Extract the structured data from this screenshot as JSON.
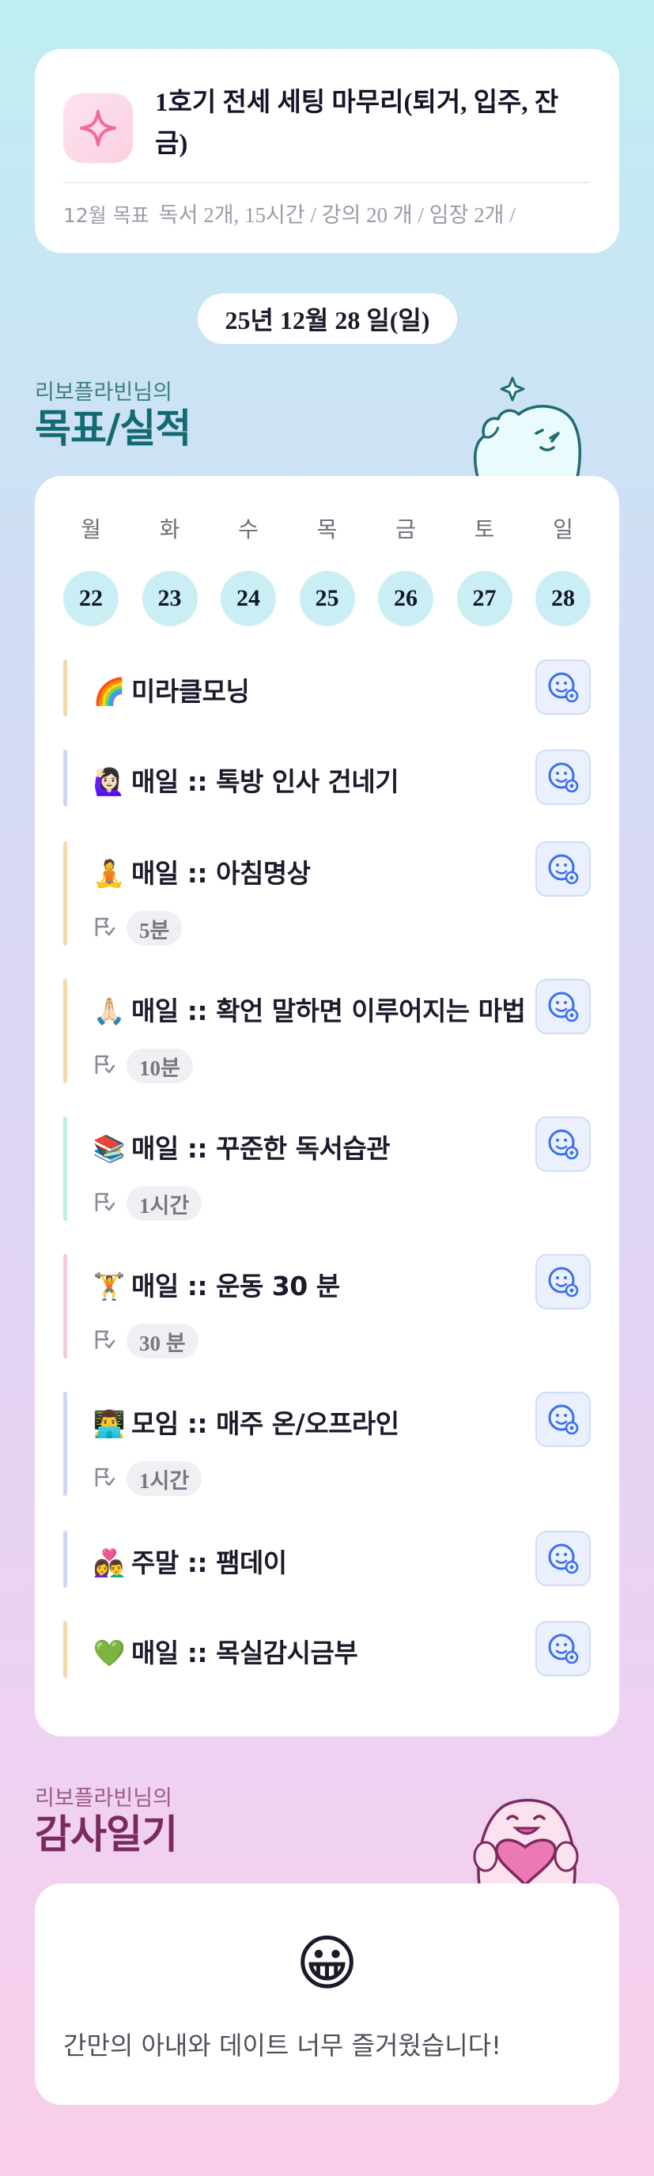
{
  "top_card": {
    "icon": "sparkle-icon",
    "title": "1호기 전세 세팅 마무리(퇴거, 입주, 잔금)",
    "meta_label": "12월 목표",
    "meta_value": "독서 2개, 15시간 / 강의 20 개 / 임장 2개 /"
  },
  "date": "25년 12월 28 일(일)",
  "goals_section": {
    "subtitle": "리보플라빈님의",
    "title": "목표/실적"
  },
  "week": [
    {
      "day": "월",
      "date": "22"
    },
    {
      "day": "화",
      "date": "23"
    },
    {
      "day": "수",
      "date": "24"
    },
    {
      "day": "목",
      "date": "25"
    },
    {
      "day": "금",
      "date": "26"
    },
    {
      "day": "토",
      "date": "27"
    },
    {
      "day": "일",
      "date": "28"
    }
  ],
  "goals": [
    {
      "emoji": "🌈",
      "title": "미라클모닝",
      "duration": "",
      "bar_color": "#f6d9a8"
    },
    {
      "emoji": "🙋🏻‍♀️",
      "title": "매일 :: 톡방 인사 건네기",
      "duration": "",
      "bar_color": "#cdd7f5"
    },
    {
      "emoji": "🧘",
      "title": "매일 :: 아침명상",
      "duration": "5분",
      "bar_color": "#f6d9a8"
    },
    {
      "emoji": "🙏🏻",
      "title": "매일 :: 확언 말하면 이루어지는 마법",
      "duration": "10분",
      "bar_color": "#f6d9a8"
    },
    {
      "emoji": "📚",
      "title": "매일 :: 꾸준한 독서습관",
      "duration": "1시간",
      "bar_color": "#bfeedd"
    },
    {
      "emoji": "🏋️",
      "title": "매일 :: 운동 30 분",
      "duration": "30 분",
      "bar_color": "#f6c9e0"
    },
    {
      "emoji": "👨‍💻",
      "title": "모임 :: 매주 온/오프라인",
      "duration": "1시간",
      "bar_color": "#cdd7f5"
    },
    {
      "emoji": "👩‍❤️‍👨",
      "title": "주말 :: 팸데이",
      "duration": "",
      "bar_color": "#cdd7f5"
    },
    {
      "emoji": "💚",
      "title": "매일 :: 목실감시금부",
      "duration": "",
      "bar_color": "#f6d9a8"
    }
  ],
  "thanks_section": {
    "subtitle": "리보플라빈님의",
    "title": "감사일기",
    "emoji": "😀",
    "text": "간만의 아내와 데이트 너무 즐거웠습니다!"
  }
}
